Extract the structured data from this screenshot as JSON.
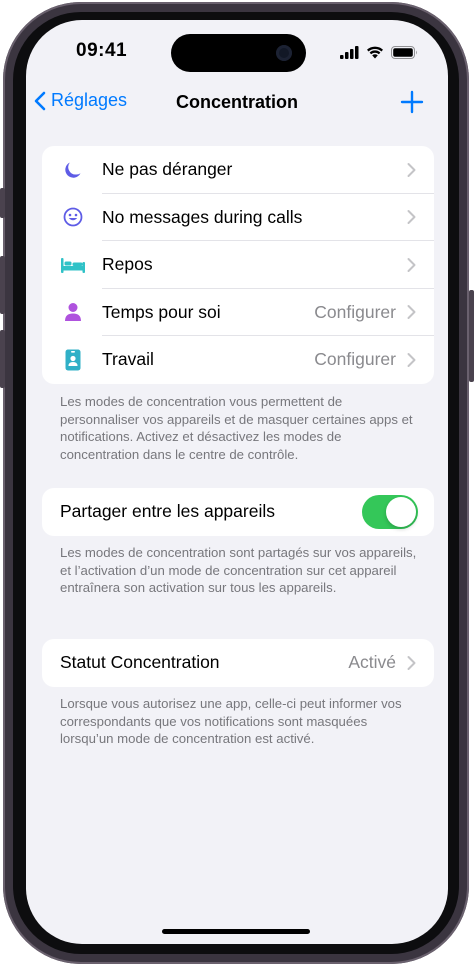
{
  "status_bar": {
    "time": "09:41"
  },
  "nav": {
    "back_label": "Réglages",
    "title": "Concentration",
    "add_icon": "plus-icon"
  },
  "focus_modes": [
    {
      "label": "Ne pas déranger",
      "value": "",
      "icon": "moon-icon",
      "color": "#5e5ce6"
    },
    {
      "label": "No messages during calls",
      "value": "",
      "icon": "smiley-icon",
      "color": "#5e5ce6"
    },
    {
      "label": "Repos",
      "value": "",
      "icon": "bed-icon",
      "color": "#30c2c7"
    },
    {
      "label": "Temps pour soi",
      "value": "Configurer",
      "icon": "person-icon",
      "color": "#af52de"
    },
    {
      "label": "Travail",
      "value": "Configurer",
      "icon": "badge-icon",
      "color": "#30b0c7"
    }
  ],
  "footnotes": {
    "modes": "Les modes de concentration vous permettent de personnaliser vos appareils et de masquer certaines apps et notifications. Activez et désactivez les modes de concentration dans le centre de contrôle.",
    "share": "Les modes de concentration sont partagés sur vos appareils, et l’activation d’un mode de concentration sur cet appareil entraînera son activation sur tous les appareils.",
    "status": "Lorsque vous autorisez une app, celle-ci peut informer vos correspondants que vos notifications sont masquées lorsqu’un mode de concentration est activé."
  },
  "share_setting": {
    "label": "Partager entre les appareils",
    "enabled": true
  },
  "status_setting": {
    "label": "Statut Concentration",
    "value": "Activé"
  },
  "colors": {
    "accent": "#007aff",
    "toggle_on": "#34c759",
    "background": "#f2f2f7"
  }
}
